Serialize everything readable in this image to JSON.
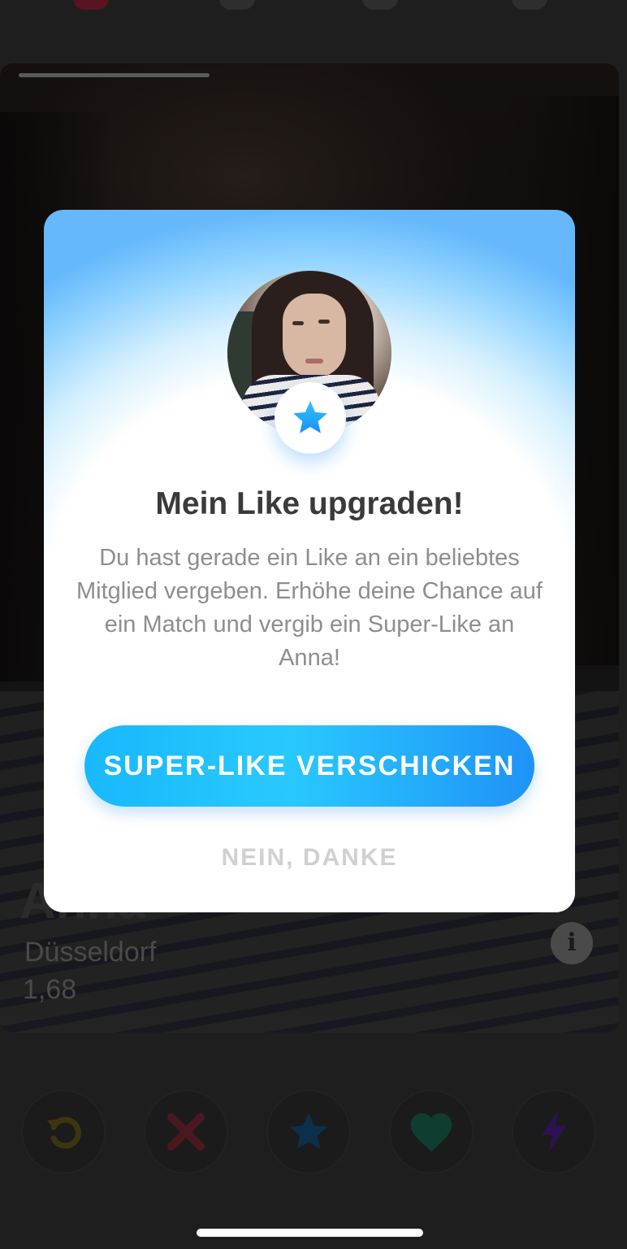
{
  "nav": {
    "icons": [
      "flame-icon",
      "explore-icon",
      "chat-icon",
      "profile-icon"
    ]
  },
  "card": {
    "name": "Anna",
    "city": "Düsseldorf",
    "height": "1,68",
    "info_label": "i"
  },
  "modal": {
    "title": "Mein Like upgraden!",
    "body": "Du hast gerade ein Like an ein beliebtes Mitglied vergeben. Erhöhe deine Chance auf ein Match und vergib ein Super-Like an Anna!",
    "primary_button": "SUPER-LIKE VERSCHICKEN",
    "secondary_button": "NEIN, DANKE",
    "badge_icon": "star-icon"
  },
  "actions": [
    {
      "name": "rewind",
      "icon": "rewind-icon",
      "color": "#f5b700"
    },
    {
      "name": "nope",
      "icon": "close-icon",
      "color": "#e8304d"
    },
    {
      "name": "super-like",
      "icon": "star-icon",
      "color": "#1da3f5"
    },
    {
      "name": "like",
      "icon": "heart-icon",
      "color": "#1ed59a"
    },
    {
      "name": "boost",
      "icon": "bolt-icon",
      "color": "#8f3cf0"
    }
  ],
  "colors": {
    "accent_blue": "#1ea7fb",
    "modal_gradient_top": "#64b8fb",
    "title_text": "#3a3a3a",
    "body_text": "#8e8e8e"
  }
}
